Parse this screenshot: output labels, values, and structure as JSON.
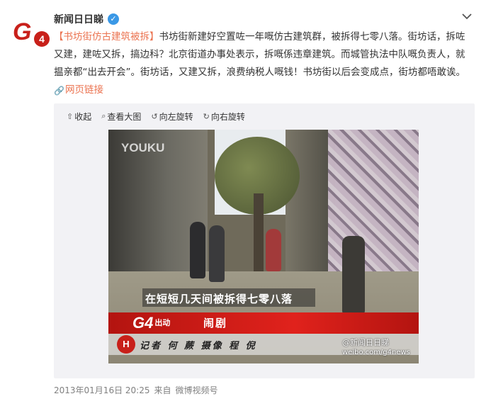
{
  "author": {
    "name": "新闻日日睇",
    "avatar_text": "G",
    "avatar_badge": "4",
    "verified_glyph": "✓"
  },
  "post": {
    "hashtag": "【书坊街仿古建筑被拆】",
    "body": "书坊街新建好空置咗一年嘅仿古建筑群，被拆得七零八落。街坊话，拆咗又建，建咗又拆，搞边科？北京街道办事处表示，拆嘅係违章建筑。而城管执法中队嘅负责人，就揾亲都“出去开会”。街坊话，又建又拆，浪费纳税人嘅钱！书坊街以后会变成点，街坊都唔敢诶。",
    "web_link_label": "网页链接"
  },
  "toolbar": {
    "collapse": "收起",
    "view_large": "查看大图",
    "rotate_left": "向左旋转",
    "rotate_right": "向右旋转"
  },
  "video": {
    "watermark": "YOUKU",
    "subtitle": "在短短几天间被拆得七零八落",
    "channel_logo": "G4",
    "channel_suffix": "出动",
    "segment_title": "闹剧",
    "credit": "记者 何 蕨 摄像 程 倪",
    "hn_badge": "H",
    "wm_account": "@新闻日日睇",
    "wm_url": "weibo.com/g4news"
  },
  "meta": {
    "timestamp": "2013年01月16日 20:25",
    "source_prefix": "来自",
    "source": "微博视频号"
  },
  "colors": {
    "link": "#eb7350",
    "brand_red": "#c8201a",
    "verified_blue": "#3a98e6"
  }
}
